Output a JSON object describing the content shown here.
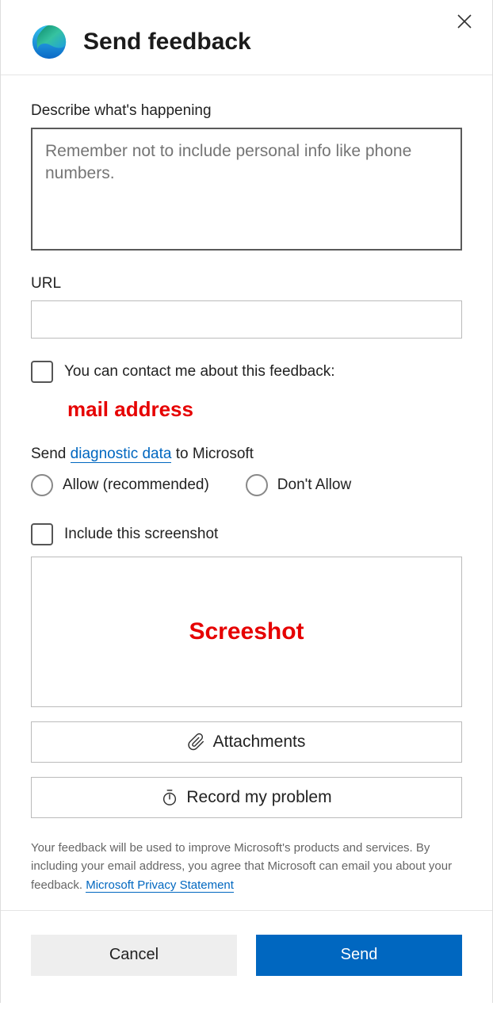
{
  "header": {
    "title": "Send feedback"
  },
  "describe": {
    "label": "Describe what's happening",
    "placeholder": "Remember not to include personal info like phone numbers."
  },
  "url": {
    "label": "URL",
    "value": ""
  },
  "contact": {
    "label": "You can contact me about this feedback:",
    "redacted": "mail address"
  },
  "diagnostic": {
    "prefix": "Send ",
    "link": "diagnostic data",
    "suffix": " to Microsoft",
    "allow": "Allow (recommended)",
    "dont_allow": "Don't Allow"
  },
  "screenshot": {
    "label": "Include this screenshot",
    "placeholder": "Screeshot"
  },
  "attachments": {
    "label": "Attachments"
  },
  "record": {
    "label": "Record my problem"
  },
  "disclaimer": {
    "text": "Your feedback will be used to improve Microsoft's products and services. By including your email address, you agree that Microsoft can email you about your feedback. ",
    "link": "Microsoft Privacy Statement"
  },
  "footer": {
    "cancel": "Cancel",
    "send": "Send"
  }
}
